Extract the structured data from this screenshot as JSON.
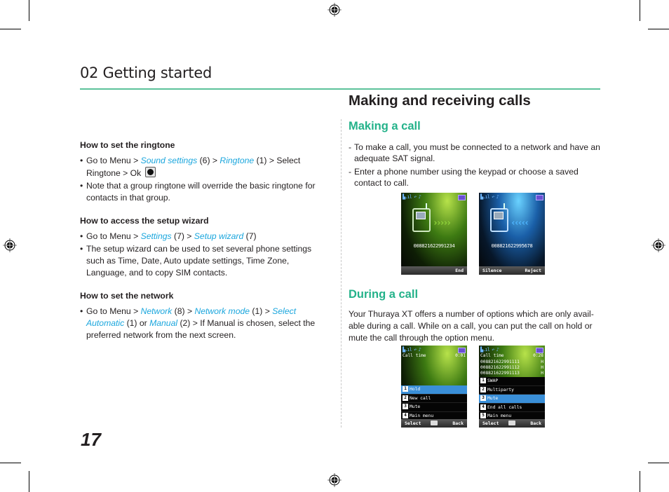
{
  "chapter": {
    "title": "02 Getting started",
    "accent_color": "#5cc29a"
  },
  "page_number": "17",
  "left": {
    "sections": [
      {
        "heading": "How to set the ringtone",
        "bullets": [
          {
            "parts": [
              "Go to Menu > ",
              "Sound settings",
              " (6) > ",
              "Ringtone",
              " (1) > Select Ringtone > Ok"
            ]
          },
          {
            "text": "Note that a group ringtone will override the basic ringtone for contacts in that group."
          }
        ]
      },
      {
        "heading": "How to access the setup wizard",
        "bullets": [
          {
            "parts": [
              "Go to Menu > ",
              "Settings",
              " (7) > ",
              "Setup wizard",
              " (7)"
            ]
          },
          {
            "text": "The setup wizard can be used to set several phone settings such as Time, Date, Auto update settings, Time Zone, Language, and to copy SIM contacts."
          }
        ]
      },
      {
        "heading": "How to set the network",
        "bullets": [
          {
            "parts": [
              "Go to Menu > ",
              "Network",
              " (8) > ",
              "Network mode",
              " (1) > ",
              "Select Automatic",
              " (1) or ",
              "Manual",
              " (2) > If Manual is chosen, select the preferred network from the next screen."
            ]
          }
        ]
      }
    ],
    "link_color": "#1aa6dd"
  },
  "right": {
    "title": "Making and receiving calls",
    "making_call": {
      "heading": "Making a call",
      "items": [
        "To make a call, you must be connected to a network and have an adequate SAT signal.",
        "Enter a phone number using the keypad or choose a saved contact to call."
      ]
    },
    "during_call": {
      "heading": "During a call",
      "text": "Your Thuraya XT offers a number of options which are only avail-able during a call. While on a call, you can put the call on hold or mute the call through the option menu."
    },
    "heading_color": "#24b28a"
  },
  "screens": {
    "outgoing": {
      "number": "008821622991234",
      "soft_right": "End",
      "arrows": "›››››"
    },
    "incoming": {
      "number": "008821622995678",
      "soft_left": "Silence",
      "soft_right": "Reject",
      "arrows": "‹‹‹‹‹"
    },
    "in_call_single": {
      "call_time_label": "Call time",
      "call_time": "0:01",
      "soft_left": "Select",
      "soft_right": "Back",
      "menu": [
        {
          "num": "1",
          "label": "Hold",
          "selected": true
        },
        {
          "num": "2",
          "label": "New call"
        },
        {
          "num": "3",
          "label": "Mute"
        },
        {
          "num": "4",
          "label": "Main menu"
        }
      ]
    },
    "in_call_multi": {
      "call_time_label": "Call time",
      "call_time": "0:28",
      "calls": [
        {
          "number": "008821622991111",
          "state": "H"
        },
        {
          "number": "008821622991112",
          "state": "H"
        },
        {
          "number": "008821622991113",
          "state": "H"
        }
      ],
      "soft_left": "Select",
      "soft_right": "Back",
      "menu": [
        {
          "num": "1",
          "label": "SWAP"
        },
        {
          "num": "2",
          "label": "Multiparty"
        },
        {
          "num": "3",
          "label": "Mute",
          "selected": true
        },
        {
          "num": "4",
          "label": "End all calls"
        },
        {
          "num": "5",
          "label": "Main menu"
        }
      ]
    }
  }
}
